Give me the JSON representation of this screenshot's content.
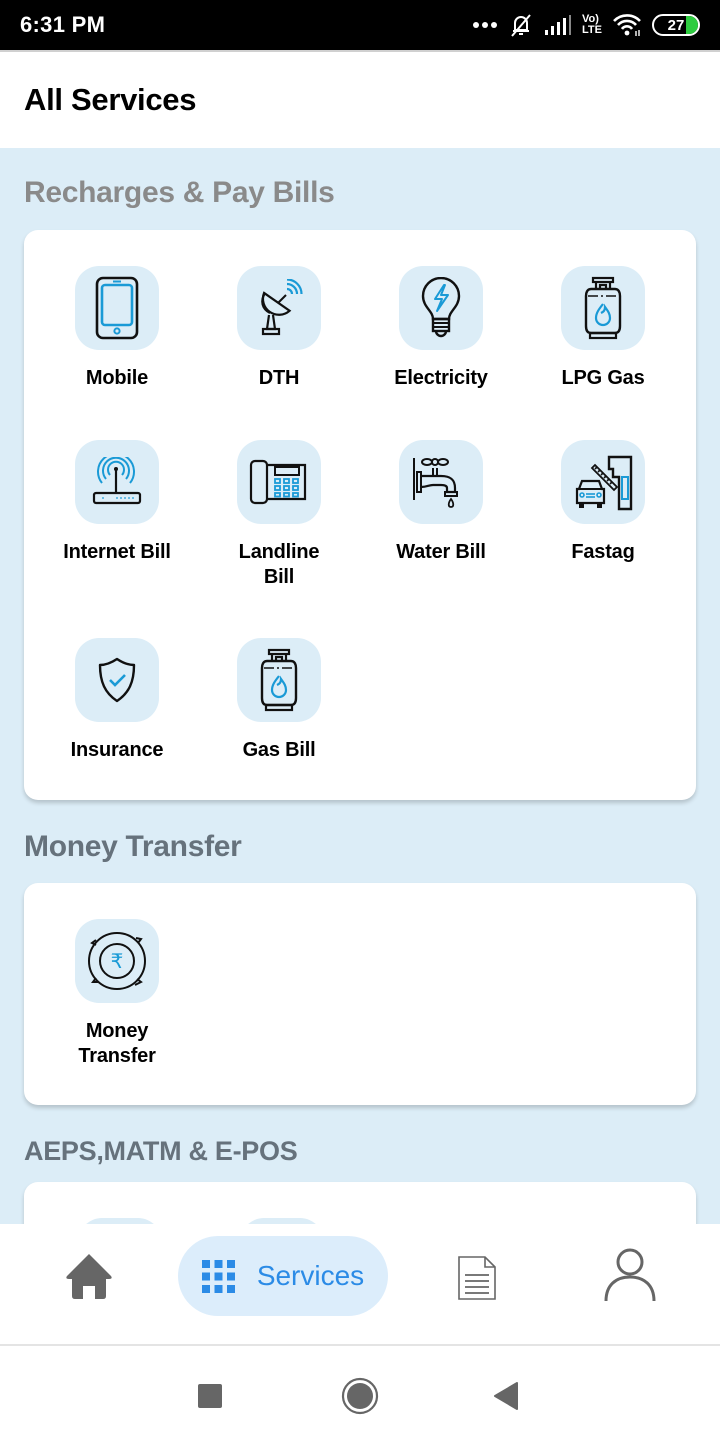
{
  "status_bar": {
    "time": "6:31 PM",
    "battery": "27",
    "icons": [
      "more-dots-icon",
      "silent-bell-icon",
      "signal-icon",
      "volte-icon",
      "wifi-icon",
      "battery-icon"
    ],
    "volte_top": "Vo)",
    "volte_bottom": "LTE"
  },
  "header": {
    "title": "All Services"
  },
  "sections": [
    {
      "title": "Recharges & Pay Bills",
      "title_color": "#8a8a8a",
      "items": [
        {
          "label": "Mobile",
          "icon": "mobile-icon"
        },
        {
          "label": "DTH",
          "icon": "satellite-dish-icon"
        },
        {
          "label": "Electricity",
          "icon": "bulb-icon"
        },
        {
          "label": "LPG Gas",
          "icon": "gas-cylinder-icon"
        },
        {
          "label": "Internet Bill",
          "icon": "router-icon"
        },
        {
          "label": "Landline Bill",
          "icon": "landline-phone-icon"
        },
        {
          "label": "Water Bill",
          "icon": "water-tap-icon"
        },
        {
          "label": "Fastag",
          "icon": "toll-gate-icon"
        },
        {
          "label": "Insurance",
          "icon": "shield-check-icon"
        },
        {
          "label": "Gas Bill",
          "icon": "gas-cylinder-icon"
        }
      ]
    },
    {
      "title": "Money Transfer",
      "title_color": "#66727c",
      "items": [
        {
          "label": "Money Transfer",
          "icon": "rupee-transfer-icon"
        }
      ]
    },
    {
      "title": "AEPS,MATM & E-POS",
      "title_color": "#66727c",
      "items": []
    }
  ],
  "bottom_nav": {
    "items": [
      {
        "name": "home",
        "icon": "home-icon",
        "label": ""
      },
      {
        "name": "services",
        "icon": "grid-icon",
        "label": "Services",
        "active": true
      },
      {
        "name": "reports",
        "icon": "document-icon",
        "label": ""
      },
      {
        "name": "profile",
        "icon": "user-icon",
        "label": ""
      }
    ]
  },
  "colors": {
    "accent": "#2b8be6",
    "icon_blue": "#1a9ad6",
    "section_bg": "#dcedf7",
    "nav_active_bg": "#dcedfb",
    "nav_icon_gray": "#666666"
  }
}
